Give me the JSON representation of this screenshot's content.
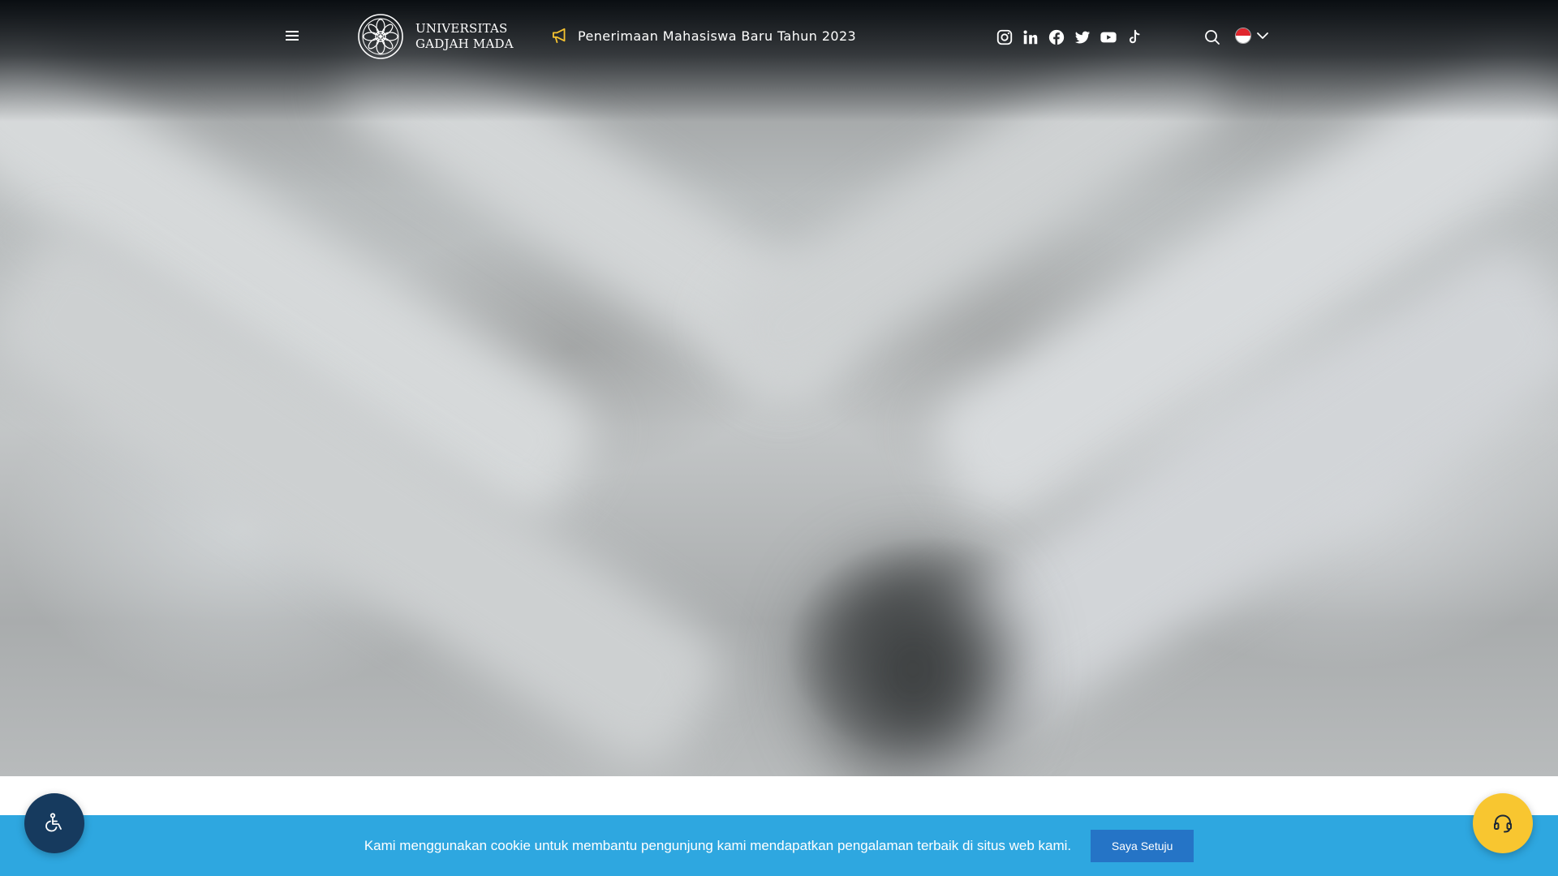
{
  "header": {
    "logo": {
      "line1": "UNIVERSITAS",
      "line2": "GADJAH MADA",
      "icon": "ugm-seal-icon"
    },
    "menu_icon": "hamburger-menu-icon",
    "announcement": {
      "icon": "megaphone-icon",
      "text": "Penerimaan Mahasiswa Baru Tahun 2023",
      "icon_color": "#f5c230"
    },
    "socials": [
      {
        "icon": "instagram-icon"
      },
      {
        "icon": "linkedin-icon"
      },
      {
        "icon": "facebook-icon"
      },
      {
        "icon": "twitter-icon"
      },
      {
        "icon": "youtube-icon"
      },
      {
        "icon": "tiktok-icon"
      }
    ],
    "search_icon": "search-icon",
    "language": {
      "icon": "indonesia-flag-icon",
      "chevron": "chevron-down-icon"
    }
  },
  "cookie": {
    "text": "Kami menggunakan cookie untuk membantu pengunjung kami mendapatkan pengalaman terbaik di situs web kami.",
    "button_label": "Saya Setuju",
    "bar_color": "#2ea7e0",
    "button_color": "#2574c6"
  },
  "floating": {
    "accessibility_icon": "wheelchair-icon",
    "accessibility_color": "#163a5e",
    "support_icon": "headset-icon",
    "support_color": "#f8c630"
  }
}
